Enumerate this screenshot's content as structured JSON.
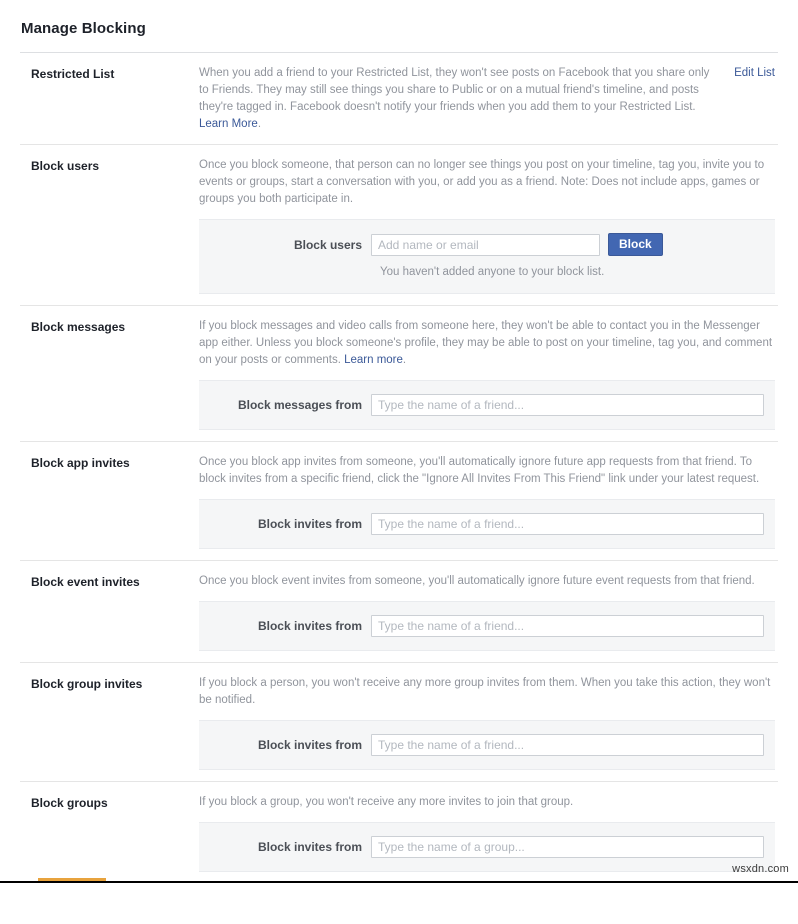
{
  "page": {
    "title": "Manage Blocking",
    "watermark": "wsxdn.com"
  },
  "sections": [
    {
      "label": "Restricted List",
      "description": "When you add a friend to your Restricted List, they won't see posts on Facebook that you share only to Friends. They may still see things you share to Public or on a mutual friend's timeline, and posts they're tagged in. Facebook doesn't notify your friends when you add them to your Restricted List. ",
      "link_text": "Learn More",
      "link_suffix": ".",
      "action_link": "Edit List"
    },
    {
      "label": "Block users",
      "description": "Once you block someone, that person can no longer see things you post on your timeline, tag you, invite you to events or groups, start a conversation with you, or add you as a friend. Note: Does not include apps, games or groups you both participate in.",
      "field_label": "Block users",
      "field_placeholder": "Add name or email",
      "field_value": "",
      "button_label": "Block",
      "hint": "You haven't added anyone to your block list."
    },
    {
      "label": "Block messages",
      "description": "If you block messages and video calls from someone here, they won't be able to contact you in the Messenger app either. Unless you block someone's profile, they may be able to post on your timeline, tag you, and comment on your posts or comments. ",
      "link_text": "Learn more",
      "link_suffix": ".",
      "field_label": "Block messages from",
      "field_placeholder": "Type the name of a friend...",
      "field_value": ""
    },
    {
      "label": "Block app invites",
      "description": "Once you block app invites from someone, you'll automatically ignore future app requests from that friend. To block invites from a specific friend, click the \"Ignore All Invites From This Friend\" link under your latest request.",
      "field_label": "Block invites from",
      "field_placeholder": "Type the name of a friend...",
      "field_value": ""
    },
    {
      "label": "Block event invites",
      "description": "Once you block event invites from someone, you'll automatically ignore future event requests from that friend.",
      "field_label": "Block invites from",
      "field_placeholder": "Type the name of a friend...",
      "field_value": ""
    },
    {
      "label": "Block group invites",
      "description": "If you block a person, you won't receive any more group invites from them. When you take this action, they won't be notified.",
      "field_label": "Block invites from",
      "field_placeholder": "Type the name of a friend...",
      "field_value": ""
    },
    {
      "label": "Block groups",
      "description": "If you block a group, you won't receive any more invites to join that group.",
      "field_label": "Block invites from",
      "field_placeholder": "Type the name of a group...",
      "field_value": ""
    }
  ],
  "colors": {
    "accent": "#3b5998",
    "button": "#4267b2",
    "panel": "#f5f6f7",
    "text": "#1d2129",
    "muted": "#90949c"
  }
}
